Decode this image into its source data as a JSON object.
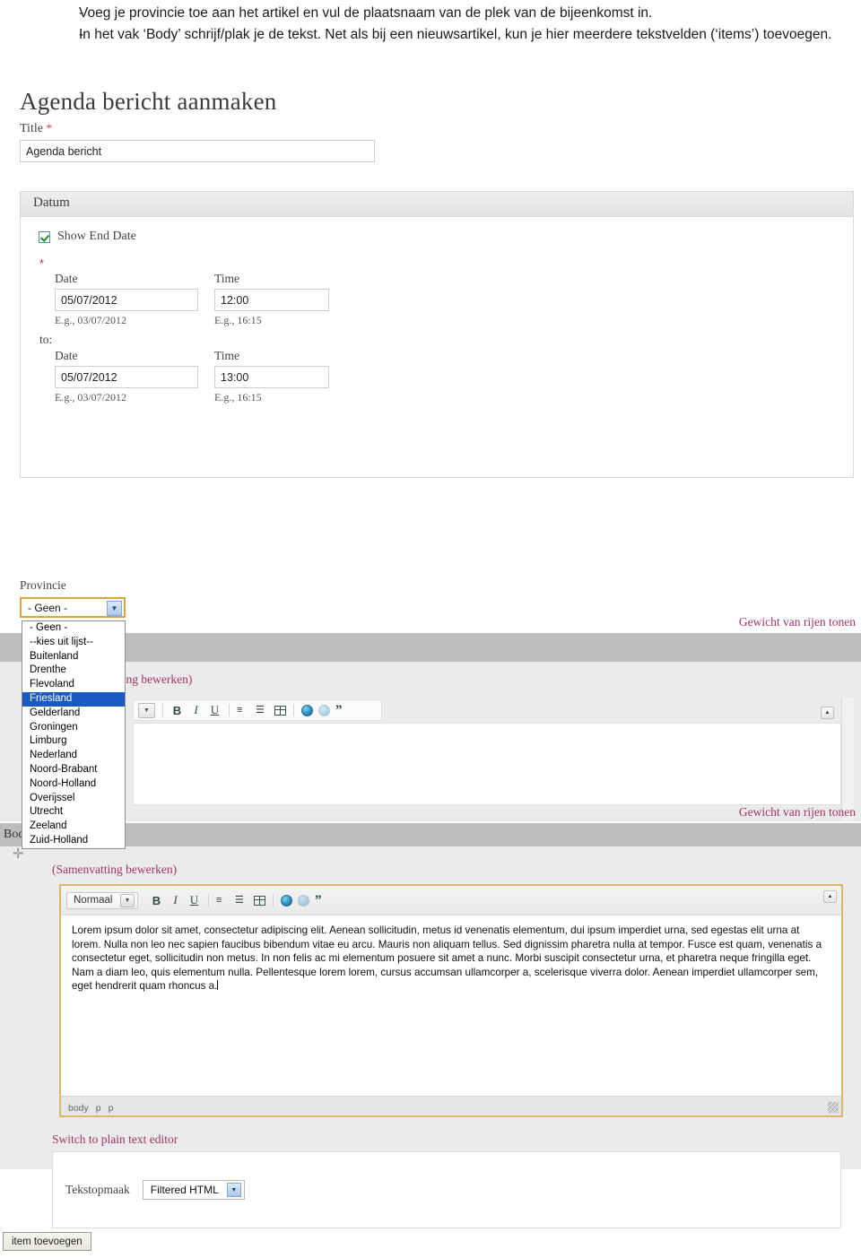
{
  "doc_intro": {
    "bullets": [
      {
        "dash": "-",
        "text": "Voeg je provincie toe aan het artikel en vul de plaatsnaam van de plek van de bijeenkomst in."
      },
      {
        "dash": "-",
        "text": "In het vak ‘Body’ schrijf/plak je de tekst. Net als bij een nieuwsartikel, kun je hier meerdere tekstvelden (‘items’) toevoegen."
      }
    ]
  },
  "page": {
    "title": "Agenda bericht aanmaken"
  },
  "title_field": {
    "label": "Title",
    "required_marker": "*",
    "value": "Agenda bericht"
  },
  "datum": {
    "legend": "Datum",
    "show_end_date_label": "Show End Date",
    "show_end_date_checked": true,
    "required_marker": "*",
    "to_label": "to:",
    "start": {
      "date_label": "Date",
      "date_value": "05/07/2012",
      "date_hint": "E.g., 03/07/2012",
      "time_label": "Time",
      "time_value": "12:00",
      "time_hint": "E.g., 16:15"
    },
    "end": {
      "date_label": "Date",
      "date_value": "05/07/2012",
      "date_hint": "E.g., 03/07/2012",
      "time_label": "Time",
      "time_value": "13:00",
      "time_hint": "E.g., 16:15"
    }
  },
  "provincie": {
    "label": "Provincie",
    "selected": "- Geen -",
    "options": [
      "- Geen -",
      "--kies uit lijst--",
      "Buitenland",
      "Drenthe",
      "Flevoland",
      "Friesland",
      "Gelderland",
      "Groningen",
      "Limburg",
      "Nederland",
      "Noord-Brabant",
      "Noord-Holland",
      "Overijssel",
      "Utrecht",
      "Zeeland",
      "Zuid-Holland"
    ],
    "highlighted_option": "Friesland",
    "highlighted_index": 5
  },
  "links": {
    "weight_rows_1": "Gewicht van rijen tonen",
    "weight_rows_2": "Gewicht van rijen tonen",
    "edit_summary_partial": "ting bewerken)",
    "edit_summary_full": "(Samenvatting bewerken)",
    "switch_plain_text": "Switch to plain text editor"
  },
  "body_section": {
    "label": "Body:",
    "drag_handle_icon": "move-icon"
  },
  "editor_toolbar": {
    "format_selected": "Normaal",
    "buttons": [
      {
        "name": "bold-button",
        "label": "B"
      },
      {
        "name": "italic-button",
        "label": "I"
      },
      {
        "name": "underline-button",
        "label": "U"
      },
      {
        "name": "ordered-list-button",
        "label": "ordered-list-icon"
      },
      {
        "name": "unordered-list-button",
        "label": "unordered-list-icon"
      },
      {
        "name": "table-button",
        "label": "table-icon"
      },
      {
        "name": "link-button",
        "label": "globe-link-icon"
      },
      {
        "name": "unlink-button",
        "label": "globe-unlink-icon"
      },
      {
        "name": "blockquote-button",
        "label": "”"
      }
    ]
  },
  "body_text": {
    "content": "Lorem ipsum dolor sit amet, consectetur adipiscing elit. Aenean sollicitudin, metus id venenatis elementum, dui ipsum imperdiet urna, sed egestas elit urna at lorem. Nulla non leo nec sapien faucibus bibendum vitae eu arcu. Mauris non aliquam tellus. Sed dignissim pharetra nulla at tempor. Fusce est quam, venenatis a consectetur eget, sollicitudin non metus. In non felis ac mi elementum posuere sit amet a nunc. Morbi suscipit consectetur urna, et pharetra neque fringilla eget. Nam a diam leo, quis elementum nulla. Pellentesque lorem lorem, cursus accumsan ullamcorper a, scelerisque viverra dolor. Aenean imperdiet ullamcorper sem, eget hendrerit quam rhoncus a."
  },
  "editor_status": {
    "path": [
      "body",
      "p",
      "p"
    ]
  },
  "text_format": {
    "label": "Tekstopmaak",
    "selected": "Filtered HTML"
  },
  "actions": {
    "add_item": "item toevoegen"
  },
  "colors": {
    "link_pink": "#a0346a",
    "required_red": "#c0392b",
    "select_highlight": "#1a58c4",
    "editor_border": "#dcb86a",
    "gray_bar": "#bdbdbd"
  }
}
